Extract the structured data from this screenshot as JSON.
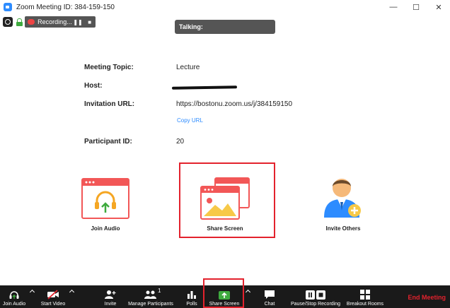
{
  "window": {
    "title": "Zoom Meeting ID: 384-159-150",
    "minimize": "—",
    "maximize": "☐",
    "close": "✕"
  },
  "recording": {
    "label": "Recording...",
    "pause": "❚❚",
    "stop": "■"
  },
  "talking": {
    "label": "Talking:"
  },
  "meeting": {
    "topic_label": "Meeting Topic:",
    "topic_value": "Lecture",
    "host_label": "Host:",
    "url_label": "Invitation URL:",
    "url_value": "https://bostonu.zoom.us/j/384159150",
    "copy_url": "Copy URL",
    "pid_label": "Participant ID:",
    "pid_value": "20"
  },
  "actions": {
    "join_audio": "Join Audio",
    "share_screen": "Share Screen",
    "invite_others": "Invite Others"
  },
  "toolbar": {
    "join_audio": "Join Audio",
    "start_video": "Start Video",
    "invite": "Invite",
    "manage_participants": "Manage Participants",
    "participant_count": "1",
    "polls": "Polls",
    "share_screen": "Share Screen",
    "chat": "Chat",
    "pause_stop_recording": "Pause/Stop Recording",
    "breakout_rooms": "Breakout Rooms",
    "end_meeting": "End Meeting"
  },
  "colors": {
    "accent_blue": "#2d8cff",
    "highlight_red": "#e3222d",
    "share_green": "#3eaa3e",
    "tile_red": "#f25757",
    "tile_yellow": "#f7c948"
  }
}
